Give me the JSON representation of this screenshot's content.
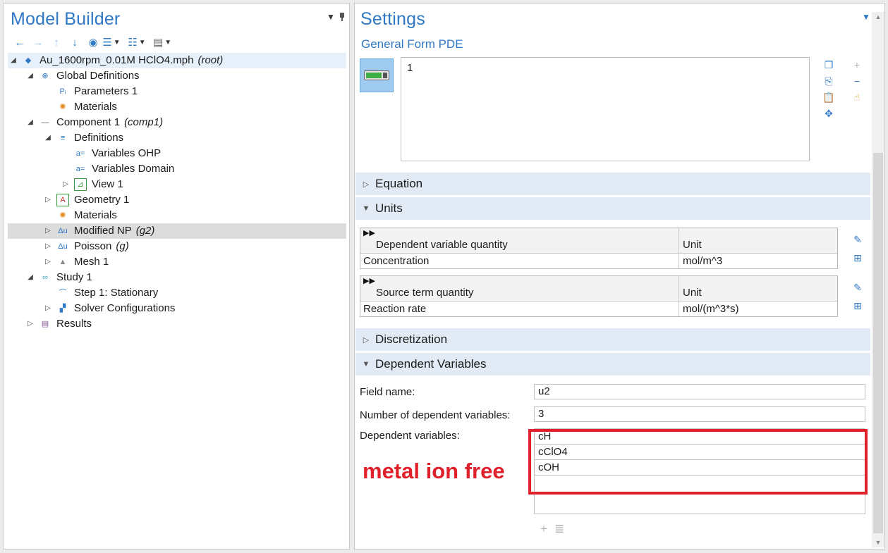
{
  "model_builder": {
    "title": "Model Builder",
    "tree": [
      {
        "label": "Au_1600rpm_0.01M HClO4.mph",
        "tag": "(root)",
        "level": 0,
        "expander": "◢",
        "icon": "model-icon",
        "glyph": "◆"
      },
      {
        "label": "Global Definitions",
        "tag": "",
        "level": 1,
        "expander": "◢",
        "icon": "globe-icon",
        "glyph": "⊕"
      },
      {
        "label": "Parameters 1",
        "tag": "",
        "level": 2,
        "expander": "",
        "icon": "parameters-icon",
        "glyph": "Pᵢ"
      },
      {
        "label": "Materials",
        "tag": "",
        "level": 2,
        "expander": "",
        "icon": "materials-icon",
        "glyph": "✺"
      },
      {
        "label": "Component 1",
        "tag": "(comp1)",
        "level": 1,
        "expander": "◢",
        "icon": "component-icon",
        "glyph": "—"
      },
      {
        "label": "Definitions",
        "tag": "",
        "level": 2,
        "expander": "◢",
        "icon": "definitions-icon",
        "glyph": "≡"
      },
      {
        "label": "Variables OHP",
        "tag": "",
        "level": 3,
        "expander": "",
        "icon": "variables-icon",
        "glyph": "a="
      },
      {
        "label": "Variables Domain",
        "tag": "",
        "level": 3,
        "expander": "",
        "icon": "variables-icon",
        "glyph": "a="
      },
      {
        "label": "View 1",
        "tag": "",
        "level": 3,
        "expander": "▷",
        "icon": "view-icon",
        "glyph": "⊿"
      },
      {
        "label": "Geometry 1",
        "tag": "",
        "level": 2,
        "expander": "▷",
        "icon": "geometry-icon",
        "glyph": "A"
      },
      {
        "label": "Materials",
        "tag": "",
        "level": 2,
        "expander": "",
        "icon": "materials-icon",
        "glyph": "✺"
      },
      {
        "label": "Modified NP",
        "tag": "(g2)",
        "level": 2,
        "expander": "▷",
        "icon": "pde-icon",
        "glyph": "Δu",
        "selected": true
      },
      {
        "label": "Poisson",
        "tag": "(g)",
        "level": 2,
        "expander": "▷",
        "icon": "pde-icon",
        "glyph": "Δu"
      },
      {
        "label": "Mesh 1",
        "tag": "",
        "level": 2,
        "expander": "▷",
        "icon": "mesh-icon",
        "glyph": "▲"
      },
      {
        "label": "Study 1",
        "tag": "",
        "level": 1,
        "expander": "◢",
        "icon": "study-icon",
        "glyph": "∞"
      },
      {
        "label": "Step 1: Stationary",
        "tag": "",
        "level": 2,
        "expander": "",
        "icon": "step-icon",
        "glyph": "⌒"
      },
      {
        "label": "Solver Configurations",
        "tag": "",
        "level": 2,
        "expander": "▷",
        "icon": "solver-icon",
        "glyph": "▞"
      },
      {
        "label": "Results",
        "tag": "",
        "level": 1,
        "expander": "▷",
        "icon": "results-icon",
        "glyph": "▤"
      }
    ]
  },
  "settings": {
    "title": "Settings",
    "subtitle": "General Form PDE",
    "expression_value": "1",
    "sections": {
      "equation": "Equation",
      "units": "Units",
      "discretization": "Discretization",
      "dependent_variables": "Dependent Variables"
    },
    "unit_tables": [
      {
        "header_quantity": "Dependent variable quantity",
        "header_unit": "Unit",
        "quantity": "Concentration",
        "unit": "mol/m^3"
      },
      {
        "header_quantity": "Source term quantity",
        "header_unit": "Unit",
        "quantity": "Reaction rate",
        "unit": "mol/(m^3*s)"
      }
    ],
    "field_name_label": "Field name:",
    "field_name_value": "u2",
    "num_vars_label": "Number of dependent variables:",
    "num_vars_value": "3",
    "dep_vars_label": "Dependent variables:",
    "dep_vars": [
      "cH",
      "cClO4",
      "cOH"
    ],
    "annotation": "metal ion free"
  },
  "colors": {
    "accent": "#2f78c4",
    "annotation_red": "#e0202a",
    "section_header": "#e2ebf5",
    "selected_row": "#dcdcdc"
  }
}
